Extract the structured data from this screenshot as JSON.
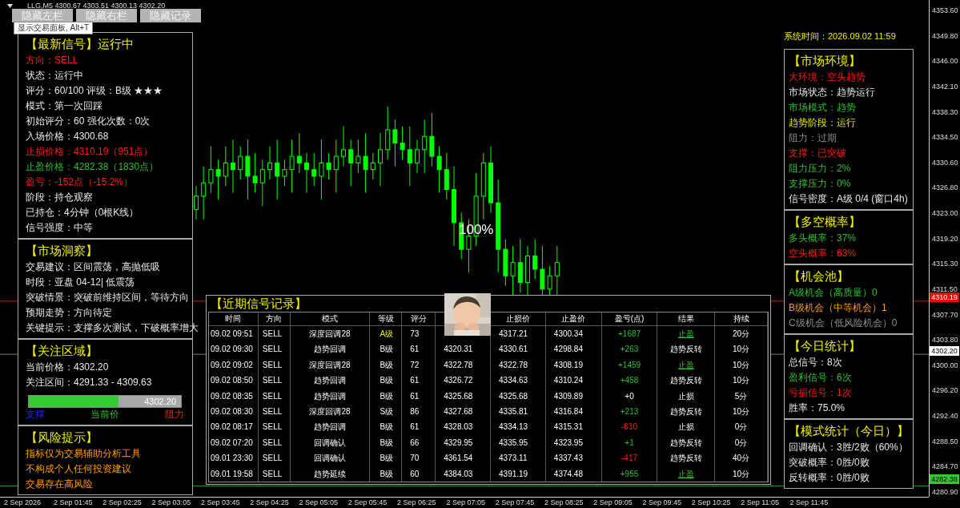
{
  "chart": {
    "header": "LLG,M5  4300.67 4303.51 4300.13 4302.20",
    "overlay_label": "100%",
    "price_axis": [
      "4353.60",
      "4349.80",
      "4346.00",
      "4342.10",
      "4338.30",
      "4334.50",
      "4330.60",
      "4326.80",
      "4323.00",
      "4319.20",
      "4315.30",
      "4311.50",
      "4307.70",
      "4303.80",
      "4300.00",
      "4296.20",
      "4292.40",
      "4288.50",
      "4284.70",
      "4280.90"
    ],
    "price_tags": [
      {
        "text": "4310.19",
        "kind": "stop"
      },
      {
        "text": "4302.20",
        "kind": "current"
      },
      {
        "text": "4282.38",
        "kind": "target"
      }
    ],
    "time_axis": [
      "2 Sep 2026",
      "2 Sep 01:45",
      "2 Sep 02:25",
      "2 Sep 03:05",
      "2 Sep 03:45",
      "2 Sep 04:25",
      "2 Sep 05:05",
      "2 Sep 05:45",
      "2 Sep 06:25",
      "2 Sep 07:05",
      "2 Sep 07:45",
      "2 Sep 08:25",
      "2 Sep 09:05",
      "2 Sep 09:45",
      "2 Sep 10:25",
      "2 Sep 11:05",
      "2 Sep 11:45"
    ]
  },
  "toolbar": {
    "buttons": [
      "隐藏左栏",
      "隐藏右栏",
      "隐藏记录"
    ],
    "tooltip": "显示交易面板, Alt+T"
  },
  "left_panel": [
    {
      "title": "【最新信号】运行中",
      "lines": [
        {
          "text": "方向：SELL",
          "kind": "loss"
        },
        {
          "text": "状态：运行中",
          "kind": "plain"
        },
        {
          "text": "评分：60/100  评级：B级 ★★★",
          "kind": "plain"
        },
        {
          "text": "模式：第一次回踩",
          "kind": "plain"
        },
        {
          "text": "初始评分：60  强化次数：0次",
          "kind": "plain"
        },
        {
          "text": "入场价格：4300.68",
          "kind": "plain"
        },
        {
          "text": "止损价格：4310.19（951点）",
          "kind": "loss"
        },
        {
          "text": "止盈价格：4282.38（1830点）",
          "kind": "gain"
        },
        {
          "text": "盈亏：-152点（-15.2%）",
          "kind": "loss"
        },
        {
          "text": "阶段：持仓观察",
          "kind": "plain"
        },
        {
          "text": "已持仓：4分钟（0根K线）",
          "kind": "plain"
        },
        {
          "text": "信号强度：中等",
          "kind": "plain"
        }
      ]
    },
    {
      "title": "【市场洞察】",
      "lines": [
        {
          "text": "交易建议：区间震荡，高抛低吸",
          "kind": "plain"
        },
        {
          "text": "时段：亚盘 04-12| 低震荡",
          "kind": "plain"
        },
        {
          "text": "突破情景：突破前维持区间，等待方向",
          "kind": "plain"
        },
        {
          "text": "预期走势：方向待定",
          "kind": "plain"
        },
        {
          "text": "关键提示：支撑多次测试，下破概率增大",
          "kind": "plain"
        }
      ]
    },
    {
      "title": "【关注区域】",
      "lines": [
        {
          "text": "当前价格：4302.20",
          "kind": "plain"
        },
        {
          "text": "关注区间：4291.33 - 4309.63",
          "kind": "plain"
        }
      ],
      "zone_bar": {
        "level": 0.59,
        "value": "4302.20",
        "labels": [
          {
            "text": "支撑",
            "kind": "support"
          },
          {
            "text": "当前价",
            "kind": "gain"
          },
          {
            "text": "阻力",
            "kind": "loss"
          }
        ]
      }
    },
    {
      "title": "【风险提示】",
      "lines": [
        {
          "text": "指标仅为交易辅助分析工具",
          "kind": "warning"
        },
        {
          "text": "不构成个人任何投资建议",
          "kind": "warning"
        },
        {
          "text": "交易存在高风险",
          "kind": "warning"
        }
      ]
    }
  ],
  "system_time": "系统时间：2026.09.02 11:59",
  "right_panel": [
    {
      "title": "【市场环境】",
      "lines": [
        {
          "text": "大环境：空头趋势",
          "kind": "loss"
        },
        {
          "text": "市场状态：趋势运行",
          "kind": "plain"
        },
        {
          "text": "市场模式：趋势",
          "kind": "gain"
        },
        {
          "text": "趋势阶段：运行",
          "kind": "highlight"
        },
        {
          "text": "阻力：过期",
          "kind": "muted"
        },
        {
          "text": "支撑：已突破",
          "kind": "loss"
        },
        {
          "text": "阻力压力：2%",
          "kind": "gain"
        },
        {
          "text": "支撑压力：0%",
          "kind": "gain"
        },
        {
          "text": "信号密度：A级 0/4 (窗口4h)",
          "kind": "plain"
        }
      ]
    },
    {
      "title": "【多空概率】",
      "lines": [
        {
          "text": "多头概率：37%",
          "kind": "gain"
        },
        {
          "text": "空头概率：63%",
          "kind": "loss"
        }
      ]
    },
    {
      "title": "【机会池】",
      "lines": [
        {
          "text": "A级机会（高质量）0",
          "kind": "gain"
        },
        {
          "text": "B级机会（中等机会）1",
          "kind": "warning"
        },
        {
          "text": "C级机会（低风险机会）0",
          "kind": "muted"
        }
      ]
    },
    {
      "title": "【今日统计】",
      "lines": [
        {
          "text": "总信号：8次",
          "kind": "plain"
        },
        {
          "text": "盈利信号：6次",
          "kind": "gain"
        },
        {
          "text": "亏损信号：1次",
          "kind": "loss"
        },
        {
          "text": "胜率：75.0%",
          "kind": "plain"
        }
      ]
    },
    {
      "title": "【模式统计（今日）】",
      "lines": [
        {
          "text": "回调确认：3胜/2败（60%）",
          "kind": "plain"
        },
        {
          "text": "突破概率：0胜/0败",
          "kind": "plain"
        },
        {
          "text": "反转概率：0胜/0败",
          "kind": "plain"
        }
      ]
    }
  ],
  "records": {
    "title": "【近期信号记录】",
    "picture": {
      "kind": "picture"
    },
    "columns": [
      "时间",
      "方向",
      "模式",
      "等级",
      "评分",
      null,
      "止损价",
      "止盈价",
      "盈亏(点)",
      "结果",
      "持续"
    ],
    "rows": [
      {
        "cells": [
          {
            "text": "09.02 09:51",
            "kind": "plain"
          },
          {
            "text": "SELL",
            "kind": "plain"
          },
          {
            "text": "深度回调28",
            "kind": "plain"
          },
          {
            "text": "A级",
            "kind": "top"
          },
          {
            "text": "73",
            "kind": "plain"
          },
          null,
          {
            "text": "4317.21",
            "kind": "plain"
          },
          {
            "text": "4300.34",
            "kind": "plain"
          },
          {
            "text": "+1687",
            "kind": "gain"
          },
          {
            "text": "止盈",
            "kind": "take_profit"
          },
          {
            "text": "20分",
            "kind": "plain"
          }
        ]
      },
      {
        "cells": [
          {
            "text": "09.02 09:30",
            "kind": "plain"
          },
          {
            "text": "SELL",
            "kind": "plain"
          },
          {
            "text": "趋势回调",
            "kind": "plain"
          },
          {
            "text": "B级",
            "kind": "plain"
          },
          {
            "text": "61",
            "kind": "plain"
          },
          {
            "text": "4320.31",
            "kind": "plain"
          },
          {
            "text": "4330.61",
            "kind": "plain"
          },
          {
            "text": "4298.84",
            "kind": "plain"
          },
          {
            "text": "+263",
            "kind": "gain"
          },
          {
            "text": "趋势反转",
            "kind": "plain"
          },
          {
            "text": "10分",
            "kind": "plain"
          }
        ]
      },
      {
        "cells": [
          {
            "text": "09.02 09:02",
            "kind": "plain"
          },
          {
            "text": "SELL",
            "kind": "plain"
          },
          {
            "text": "深度回调28",
            "kind": "plain"
          },
          {
            "text": "B级",
            "kind": "plain"
          },
          {
            "text": "72",
            "kind": "plain"
          },
          {
            "text": "4322.78",
            "kind": "plain"
          },
          {
            "text": "4322.78",
            "kind": "plain"
          },
          {
            "text": "4308.19",
            "kind": "plain"
          },
          {
            "text": "+1459",
            "kind": "gain"
          },
          {
            "text": "止盈",
            "kind": "take_profit"
          },
          {
            "text": "10分",
            "kind": "plain"
          }
        ]
      },
      {
        "cells": [
          {
            "text": "09.02 08:50",
            "kind": "plain"
          },
          {
            "text": "SELL",
            "kind": "plain"
          },
          {
            "text": "趋势回调",
            "kind": "plain"
          },
          {
            "text": "B级",
            "kind": "plain"
          },
          {
            "text": "61",
            "kind": "plain"
          },
          {
            "text": "4326.72",
            "kind": "plain"
          },
          {
            "text": "4334.63",
            "kind": "plain"
          },
          {
            "text": "4310.24",
            "kind": "plain"
          },
          {
            "text": "+458",
            "kind": "gain"
          },
          {
            "text": "趋势反转",
            "kind": "plain"
          },
          {
            "text": "10分",
            "kind": "plain"
          }
        ]
      },
      {
        "cells": [
          {
            "text": "09.02 08:35",
            "kind": "plain"
          },
          {
            "text": "SELL",
            "kind": "plain"
          },
          {
            "text": "趋势回调",
            "kind": "plain"
          },
          {
            "text": "B级",
            "kind": "plain"
          },
          {
            "text": "61",
            "kind": "plain"
          },
          {
            "text": "4325.68",
            "kind": "plain"
          },
          {
            "text": "4325.68",
            "kind": "plain"
          },
          {
            "text": "4309.89",
            "kind": "plain"
          },
          {
            "text": "+0",
            "kind": "plain"
          },
          {
            "text": "止损",
            "kind": "plain"
          },
          {
            "text": "5分",
            "kind": "plain"
          }
        ]
      },
      {
        "cells": [
          {
            "text": "09.02 08:30",
            "kind": "plain"
          },
          {
            "text": "SELL",
            "kind": "plain"
          },
          {
            "text": "深度回调28",
            "kind": "plain"
          },
          {
            "text": "S级",
            "kind": "plain"
          },
          {
            "text": "86",
            "kind": "plain"
          },
          {
            "text": "4327.68",
            "kind": "plain"
          },
          {
            "text": "4335.81",
            "kind": "plain"
          },
          {
            "text": "4316.84",
            "kind": "plain"
          },
          {
            "text": "+213",
            "kind": "gain"
          },
          {
            "text": "趋势反转",
            "kind": "plain"
          },
          {
            "text": "10分",
            "kind": "plain"
          }
        ]
      },
      {
        "cells": [
          {
            "text": "09.02 08:17",
            "kind": "plain"
          },
          {
            "text": "SELL",
            "kind": "plain"
          },
          {
            "text": "趋势回调",
            "kind": "plain"
          },
          {
            "text": "B级",
            "kind": "plain"
          },
          {
            "text": "61",
            "kind": "plain"
          },
          {
            "text": "4328.03",
            "kind": "plain"
          },
          {
            "text": "4334.13",
            "kind": "plain"
          },
          {
            "text": "4315.31",
            "kind": "plain"
          },
          {
            "text": "-610",
            "kind": "loss"
          },
          {
            "text": "止损",
            "kind": "plain"
          },
          {
            "text": "0分",
            "kind": "plain"
          }
        ]
      },
      {
        "cells": [
          {
            "text": "09.02 07:20",
            "kind": "plain"
          },
          {
            "text": "SELL",
            "kind": "plain"
          },
          {
            "text": "回调确认",
            "kind": "plain"
          },
          {
            "text": "B级",
            "kind": "plain"
          },
          {
            "text": "66",
            "kind": "plain"
          },
          {
            "text": "4329.95",
            "kind": "plain"
          },
          {
            "text": "4335.95",
            "kind": "plain"
          },
          {
            "text": "4323.95",
            "kind": "plain"
          },
          {
            "text": "+1",
            "kind": "gain"
          },
          {
            "text": "趋势反转",
            "kind": "plain"
          },
          {
            "text": "0分",
            "kind": "plain"
          }
        ]
      },
      {
        "cells": [
          {
            "text": "09.01 23:30",
            "kind": "plain"
          },
          {
            "text": "SELL",
            "kind": "plain"
          },
          {
            "text": "回调确认",
            "kind": "plain"
          },
          {
            "text": "B级",
            "kind": "plain"
          },
          {
            "text": "70",
            "kind": "plain"
          },
          {
            "text": "4361.54",
            "kind": "plain"
          },
          {
            "text": "4373.11",
            "kind": "plain"
          },
          {
            "text": "4337.43",
            "kind": "plain"
          },
          {
            "text": "-417",
            "kind": "loss"
          },
          {
            "text": "趋势反转",
            "kind": "plain"
          },
          {
            "text": "40分",
            "kind": "plain"
          }
        ]
      },
      {
        "cells": [
          {
            "text": "09.01 19:58",
            "kind": "plain"
          },
          {
            "text": "SELL",
            "kind": "plain"
          },
          {
            "text": "趋势延续",
            "kind": "plain"
          },
          {
            "text": "B级",
            "kind": "plain"
          },
          {
            "text": "60",
            "kind": "plain"
          },
          {
            "text": "4384.03",
            "kind": "plain"
          },
          {
            "text": "4391.19",
            "kind": "plain"
          },
          {
            "text": "4374.48",
            "kind": "plain"
          },
          {
            "text": "+955",
            "kind": "gain"
          },
          {
            "text": "止盈",
            "kind": "take_profit"
          },
          {
            "text": "10分",
            "kind": "plain"
          }
        ]
      }
    ]
  }
}
